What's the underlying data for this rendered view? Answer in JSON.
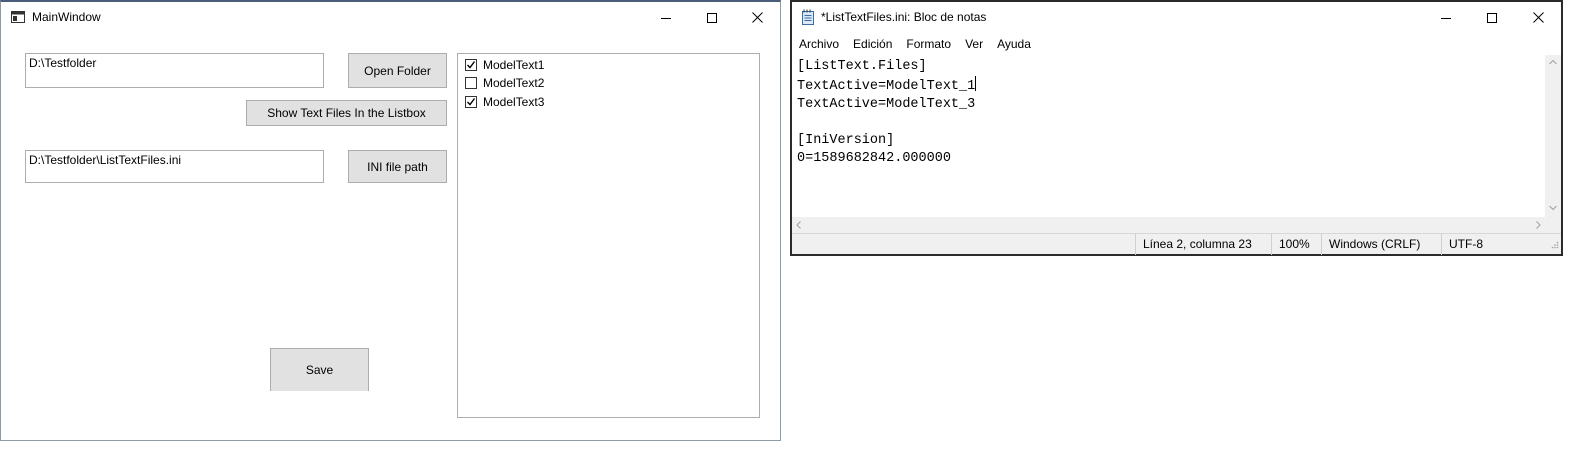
{
  "main_window": {
    "title": "MainWindow",
    "folder_path": "D:\\Testfolder",
    "open_folder_label": "Open Folder",
    "show_files_label": "Show Text Files In the Listbox",
    "ini_path": "D:\\Testfolder\\ListTextFiles.ini",
    "ini_button_label": "INI file path",
    "save_label": "Save",
    "list_items": [
      {
        "label": "ModelText1",
        "checked": true
      },
      {
        "label": "ModelText2",
        "checked": false
      },
      {
        "label": "ModelText3",
        "checked": true
      }
    ]
  },
  "notepad": {
    "title": "*ListTextFiles.ini: Bloc de notas",
    "menu": [
      "Archivo",
      "Edición",
      "Formato",
      "Ver",
      "Ayuda"
    ],
    "lines": [
      "[ListText.Files]",
      "TextActive=ModelText_1",
      "TextActive=ModelText_3",
      "",
      "[IniVersion]",
      "0=1589682842.000000"
    ],
    "status": {
      "position": "Línea 2, columna 23",
      "zoom": "100%",
      "line_ending": "Windows (CRLF)",
      "encoding": "UTF-8"
    }
  },
  "icons": {
    "app": "window-app-icon",
    "notepad": "notepad-icon",
    "minimize": "minimize-icon",
    "maximize": "maximize-icon",
    "close": "close-icon"
  }
}
